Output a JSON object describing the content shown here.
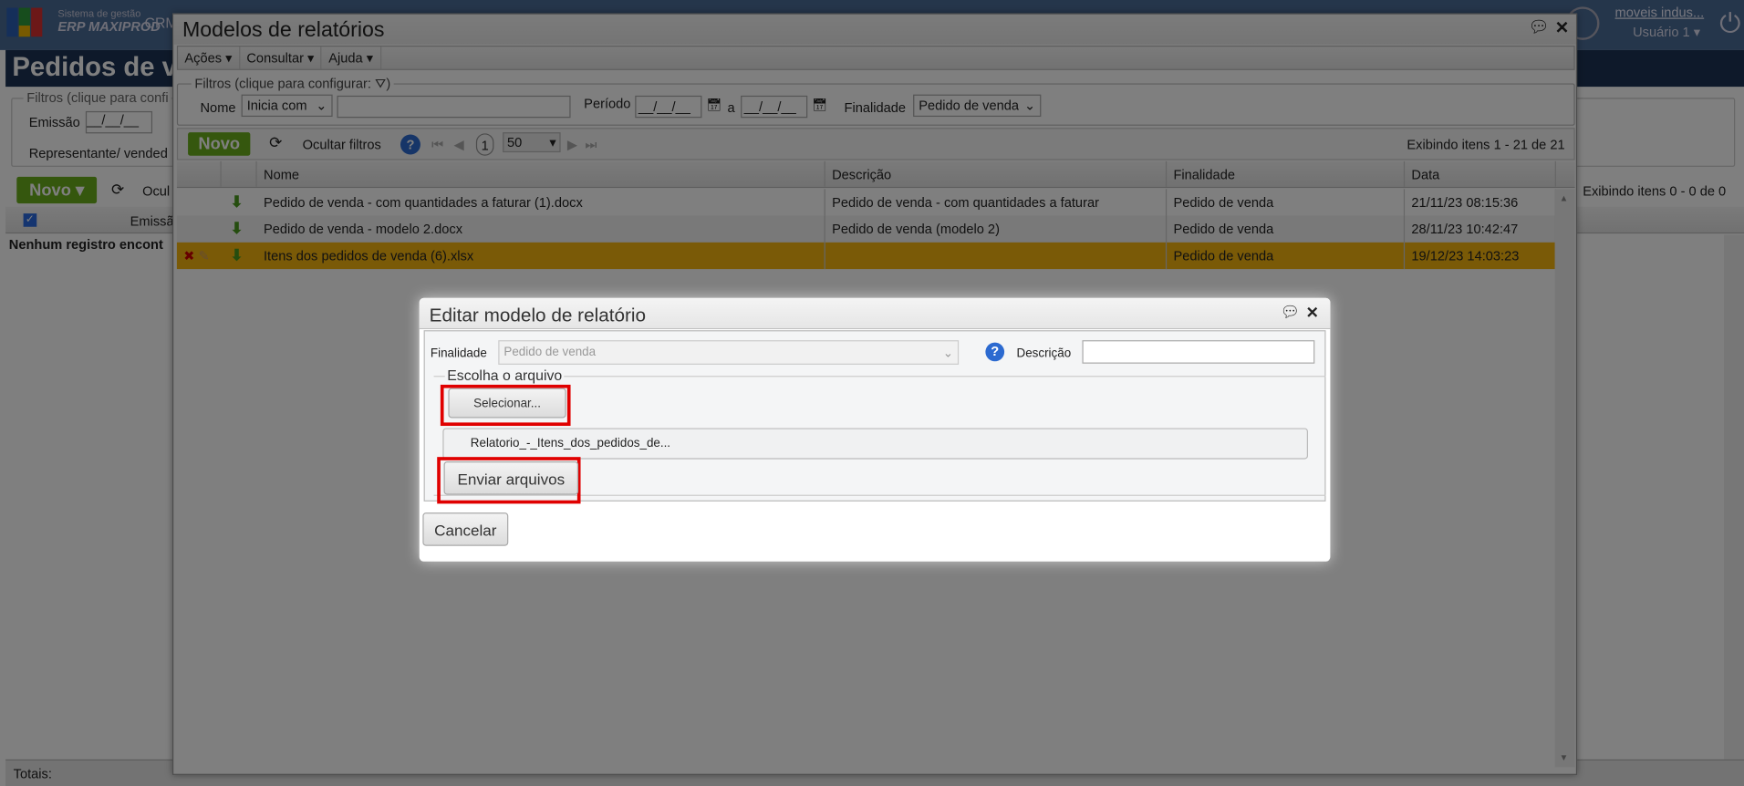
{
  "app": {
    "logo_line1": "Sistema de gestão",
    "logo_line2": "ERP MAXIPROD",
    "crm": "CRM",
    "company_link": "moveis indus...",
    "user": "Usuário 1"
  },
  "page": {
    "title": "Pedidos de v",
    "filters_legend": "Filtros (clique para confi",
    "emissao_label": "Emissão",
    "date_placeholder": "__/__/__",
    "representante_label": "Representante/ vended",
    "novo": "Novo",
    "ocultar": "Ocul",
    "col_emissao": "Emissã",
    "empty": "Nenhum registro encont",
    "paging": "Exibindo itens 0 - 0 de 0",
    "totais": "Totais:"
  },
  "modal": {
    "title": "Modelos de relatórios",
    "menu": [
      "Ações",
      "Consultar",
      "Ajuda"
    ],
    "filters": {
      "legend": "Filtros (clique para configurar:",
      "legend_end": ")",
      "nome_label": "Nome",
      "nome_op": "Inicia com",
      "nome_value": "",
      "periodo_label": "Período",
      "date_placeholder": "__/__/__",
      "a_label": "a",
      "finalidade_label": "Finalidade",
      "finalidade_value": "Pedido de venda"
    },
    "toolbar": {
      "novo": "Novo",
      "ocultar": "Ocultar filtros",
      "page": "1",
      "page_size": "50",
      "paging": "Exibindo itens 1 - 21 de 21"
    },
    "columns": [
      "Nome",
      "Descrição",
      "Finalidade",
      "Data"
    ],
    "rows": [
      {
        "nome": "Pedido de venda - com quantidades a faturar (1).docx",
        "descricao": "Pedido de venda - com quantidades a faturar",
        "finalidade": "Pedido de venda",
        "data": "21/11/23 08:15:36",
        "selected": false
      },
      {
        "nome": "Pedido de venda - modelo 2.docx",
        "descricao": "Pedido de venda (modelo 2)",
        "finalidade": "Pedido de venda",
        "data": "28/11/23 10:42:47",
        "selected": false
      },
      {
        "nome": "Itens dos pedidos de venda (6).xlsx",
        "descricao": "",
        "finalidade": "Pedido de venda",
        "data": "19/12/23 14:03:23",
        "selected": true
      }
    ]
  },
  "dialog": {
    "title": "Editar modelo de relatório",
    "finalidade_label": "Finalidade",
    "finalidade_value": "Pedido de venda",
    "descricao_label": "Descrição",
    "descricao_value": "",
    "file_legend": "Escolha o arquivo",
    "select_button": "Selecionar...",
    "file_name": "Relatorio_-_Itens_dos_pedidos_de...",
    "send_button": "Enviar arquivos",
    "cancel_button": "Cancelar"
  },
  "colors": {
    "accent_green": "#6aae1c",
    "selected_row": "#f5b50f",
    "highlight": "#e00000",
    "header_navy": "#1d3354"
  }
}
